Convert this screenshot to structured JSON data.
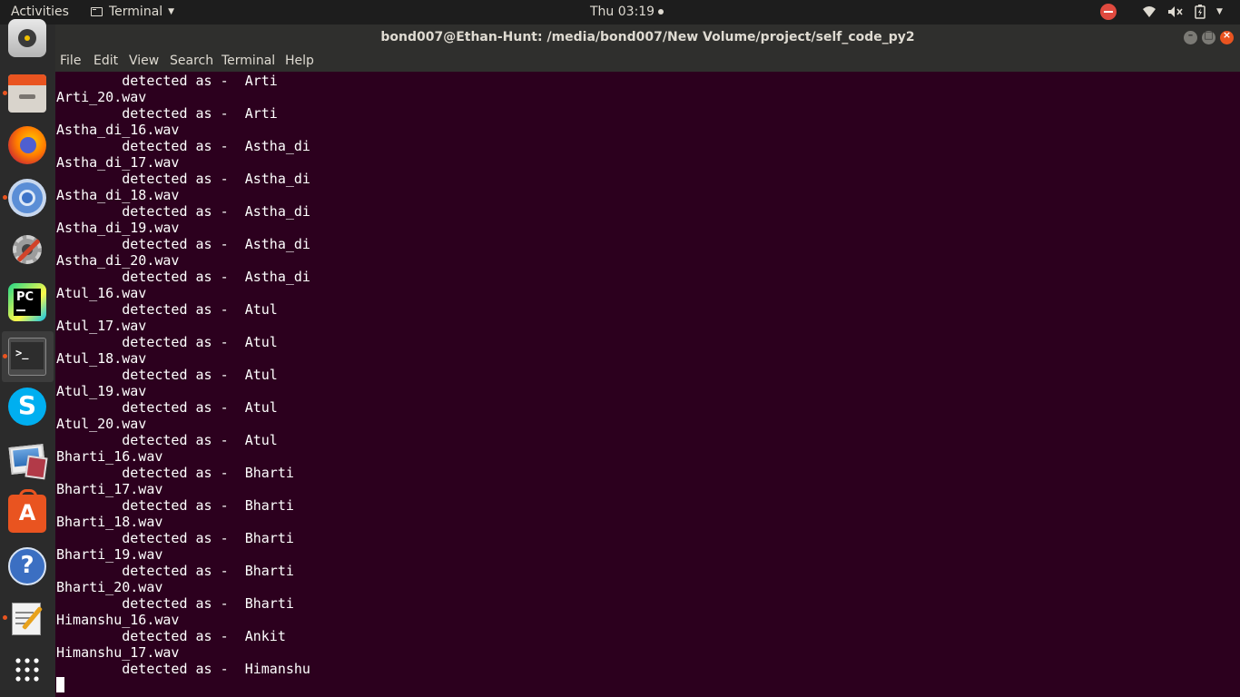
{
  "topbar": {
    "activities": "Activities",
    "app_menu": "Terminal",
    "clock": "Thu 03:19"
  },
  "window": {
    "title": "bond007@Ethan-Hunt: /media/bond007/New Volume/project/self_code_py2"
  },
  "menu": [
    "File",
    "Edit",
    "View",
    "Search",
    "Terminal",
    "Help"
  ],
  "dock": {
    "items": [
      "rhythmbox-icon",
      "files-icon",
      "firefox-icon",
      "chromium-icon",
      "settings-icon",
      "pycharm-icon",
      "terminal-icon",
      "skype-icon",
      "image-viewer-icon",
      "software-center-icon",
      "help-icon",
      "text-editor-icon",
      "show-apps-icon"
    ],
    "running": [
      "files-icon",
      "chromium-icon",
      "terminal-icon",
      "text-editor-icon"
    ]
  },
  "terminal": {
    "lines": [
      "        detected as -  Arti",
      "Arti_20.wav",
      "        detected as -  Arti",
      "Astha_di_16.wav",
      "        detected as -  Astha_di",
      "Astha_di_17.wav",
      "        detected as -  Astha_di",
      "Astha_di_18.wav",
      "        detected as -  Astha_di",
      "Astha_di_19.wav",
      "        detected as -  Astha_di",
      "Astha_di_20.wav",
      "        detected as -  Astha_di",
      "Atul_16.wav",
      "        detected as -  Atul",
      "Atul_17.wav",
      "        detected as -  Atul",
      "Atul_18.wav",
      "        detected as -  Atul",
      "Atul_19.wav",
      "        detected as -  Atul",
      "Atul_20.wav",
      "        detected as -  Atul",
      "Bharti_16.wav",
      "        detected as -  Bharti",
      "Bharti_17.wav",
      "        detected as -  Bharti",
      "Bharti_18.wav",
      "        detected as -  Bharti",
      "Bharti_19.wav",
      "        detected as -  Bharti",
      "Bharti_20.wav",
      "        detected as -  Bharti",
      "Himanshu_16.wav",
      "        detected as -  Ankit",
      "Himanshu_17.wav",
      "        detected as -  Himanshu"
    ]
  },
  "colors": {
    "terminal_bg": "#2c001e",
    "topbar_bg": "#1d1d1d",
    "dock_bg": "#2b2b2b",
    "accent": "#e95420"
  }
}
